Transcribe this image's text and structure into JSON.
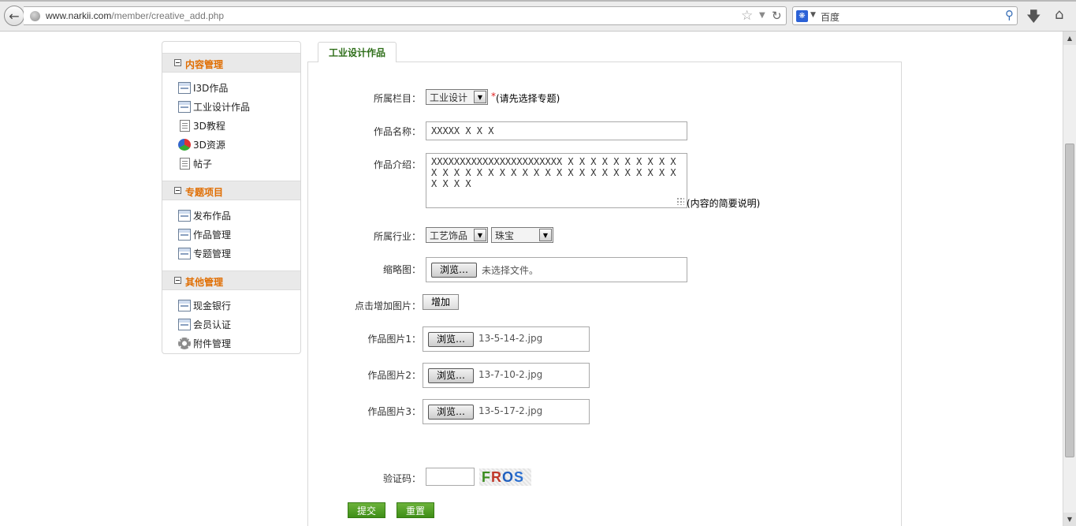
{
  "browser": {
    "url_host": "www.narkii.com",
    "url_path": "/member/creative_add.php",
    "search_placeholder": "百度",
    "icons": [
      "back-arrow-icon",
      "globe-icon",
      "star-icon",
      "reload-icon",
      "search-icon",
      "download-icon",
      "home-icon"
    ]
  },
  "sidebar": {
    "sections": [
      {
        "title": "内容管理",
        "items": [
          {
            "label": "I3D作品",
            "icon": "window-icon"
          },
          {
            "label": "工业设计作品",
            "icon": "window-icon"
          },
          {
            "label": "3D教程",
            "icon": "document-icon"
          },
          {
            "label": "3D资源",
            "icon": "ball-icon"
          },
          {
            "label": "帖子",
            "icon": "document-icon"
          }
        ]
      },
      {
        "title": "专题项目",
        "items": [
          {
            "label": "发布作品",
            "icon": "window-icon"
          },
          {
            "label": "作品管理",
            "icon": "window-icon"
          },
          {
            "label": "专题管理",
            "icon": "window-icon"
          }
        ]
      },
      {
        "title": "其他管理",
        "items": [
          {
            "label": "现金银行",
            "icon": "window-icon"
          },
          {
            "label": "会员认证",
            "icon": "window-icon"
          },
          {
            "label": "附件管理",
            "icon": "gear-icon"
          }
        ]
      }
    ]
  },
  "main": {
    "tab_label": "工业设计作品",
    "category": {
      "label": "所属栏目：",
      "value": "工业设计",
      "required_mark": "*",
      "hint": "(请先选择专题)"
    },
    "name": {
      "label": "作品名称：",
      "value": "XXXXX X X X"
    },
    "intro": {
      "label": "作品介绍：",
      "value": "XXXXXXXXXXXXXXXXXXXXXXX X X X X X X X X X X X X X X X X X X X X X X X X X X X X X X X X X X X X",
      "hint": "(内容的简要说明)"
    },
    "industry": {
      "label": "所属行业：",
      "value1": "工艺饰品",
      "value2": "珠宝"
    },
    "thumbnail": {
      "label": "缩略图：",
      "browse": "浏览…",
      "filename": "未选择文件。"
    },
    "add_image": {
      "label": "点击增加图片：",
      "button": "增加"
    },
    "images": [
      {
        "label": "作品图片1：",
        "browse": "浏览…",
        "filename": "13-5-14-2.jpg"
      },
      {
        "label": "作品图片2：",
        "browse": "浏览…",
        "filename": "13-7-10-2.jpg"
      },
      {
        "label": "作品图片3：",
        "browse": "浏览…",
        "filename": "13-5-17-2.jpg"
      }
    ],
    "captcha": {
      "label": "验证码：",
      "value": "",
      "letters": [
        "F",
        "R",
        "O",
        "S"
      ],
      "letter_colors": [
        "#3b8c1f",
        "#c0392b",
        "#1f5fbf",
        "#2a6fd0"
      ]
    },
    "submit_label": "提交",
    "reset_label": "重置"
  }
}
